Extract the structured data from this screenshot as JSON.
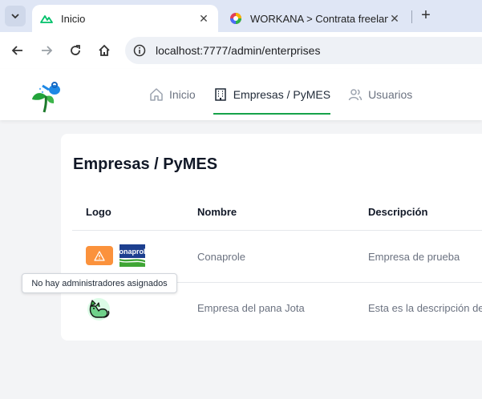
{
  "browser": {
    "tabs": [
      {
        "title": "Inicio",
        "active": true,
        "favicon": "nuxt-icon"
      },
      {
        "title": "WORKANA > Contrata freelance",
        "active": false,
        "favicon": "workana-icon"
      }
    ],
    "url": "localhost:7777/admin/enterprises"
  },
  "app": {
    "nav": [
      {
        "label": "Inicio",
        "icon": "home-icon",
        "active": false
      },
      {
        "label": "Empresas / PyMES",
        "icon": "building-icon",
        "active": true
      },
      {
        "label": "Usuarios",
        "icon": "users-icon",
        "active": false
      }
    ],
    "accent": "#16a34a"
  },
  "page": {
    "title": "Empresas / PyMES",
    "table": {
      "headers": [
        "Logo",
        "Nombre",
        "Descripción"
      ],
      "rows": [
        {
          "name": "Conaprole",
          "description": "Empresa de prueba",
          "logo_text": "conaprole",
          "warning": true
        },
        {
          "name": "Empresa del pana Jota",
          "description": "Esta es la descripción de",
          "logo_text": "",
          "warning": false
        }
      ]
    },
    "tooltip": "No hay administradores asignados"
  }
}
